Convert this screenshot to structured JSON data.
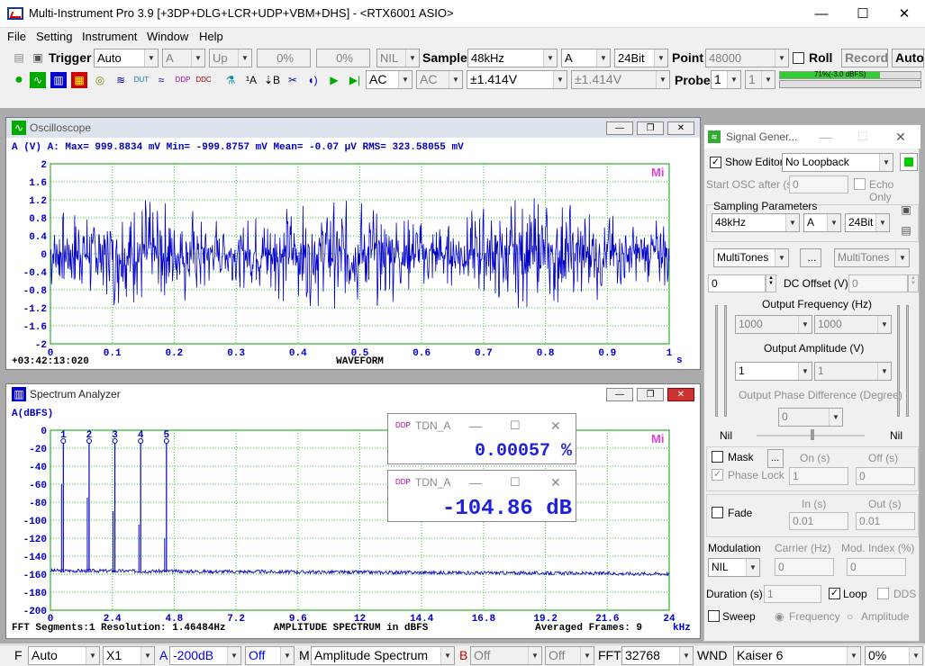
{
  "window": {
    "title": "Multi-Instrument Pro 3.9    [+3DP+DLG+LCR+UDP+VBM+DHS]    -    <RTX6001 ASIO>",
    "min": "—",
    "max": "☐",
    "close": "✕"
  },
  "menu": [
    "File",
    "Setting",
    "Instrument",
    "Window",
    "Help"
  ],
  "toolbar1": {
    "trigger_label": "Trigger",
    "trigger_mode": "Auto",
    "channel": "A",
    "edge": "Up",
    "level1": "0%",
    "level2": "0%",
    "nil": "NIL",
    "sample_label": "Sample",
    "sample_rate": "48kHz",
    "sample_ch": "A",
    "bits": "24Bit",
    "point_label": "Point",
    "points": "48000",
    "roll_label": "Roll",
    "record_label": "Record",
    "auto_label": "Auto"
  },
  "toolbar2": {
    "coupling_a": "AC",
    "coupling_b": "AC",
    "range_a": "±1.414V",
    "range_b": "±1.414V",
    "probe_label": "Probe",
    "probe_a": "1",
    "probe_b": "1",
    "meter_text": "71%(-3.0 dBFS)"
  },
  "oscilloscope": {
    "title": "Oscilloscope",
    "header": "A (V)      A: Max=   999.8834 mV  Min=  -999.8757 mV  Mean=        -0.07 μV  RMS=    323.58055 mV",
    "y_ticks": [
      "2",
      "1.6",
      "1.2",
      "0.8",
      "0.4",
      "0",
      "-0.4",
      "-0.8",
      "-1.2",
      "-1.6",
      "-2"
    ],
    "x_ticks": [
      "0",
      "0.1",
      "0.2",
      "0.3",
      "0.4",
      "0.5",
      "0.6",
      "0.7",
      "0.8",
      "0.9",
      "1"
    ],
    "x_unit": "s",
    "timestamp": "+03:42:13:020",
    "mode_label": "WAVEFORM",
    "logo": "Mi"
  },
  "spectrum": {
    "title": "Spectrum Analyzer",
    "header": "A(dBFS)",
    "y_ticks": [
      "0",
      "-20",
      "-40",
      "-60",
      "-80",
      "-100",
      "-120",
      "-140",
      "-160",
      "-180",
      "-200"
    ],
    "x_ticks": [
      "0",
      "2.4",
      "4.8",
      "7.2",
      "9.6",
      "12",
      "14.4",
      "16.8",
      "19.2",
      "21.6",
      "24"
    ],
    "x_unit": "kHz",
    "footer_left": "FFT Segments:1    Resolution: 1.46484Hz",
    "footer_mid": "AMPLITUDE SPECTRUM in dBFS",
    "footer_right": "Averaged Frames: 9",
    "logo": "Mi",
    "markers": [
      "1",
      "2",
      "3",
      "4",
      "5"
    ]
  },
  "chart_data": {
    "type": "line",
    "title": "",
    "xlabel": "",
    "ylabel": "A(dBFS)",
    "xlim": [
      0,
      24
    ],
    "ylim": [
      -200,
      0
    ],
    "series": [
      {
        "values": [
          [
            0.5,
            -12
          ],
          [
            1.5,
            -12
          ],
          [
            2.5,
            -12
          ],
          [
            3.5,
            -12
          ],
          [
            4.5,
            -12
          ]
        ]
      }
    ]
  },
  "tdn1": {
    "title": "TDN_A",
    "value": "0.00057 %"
  },
  "tdn2": {
    "title": "TDN_A",
    "value": "-104.86 dB"
  },
  "siggen": {
    "title": "Signal Gener...",
    "show_editor": "Show Editor",
    "loopback": "No Loopback",
    "start_osc": "Start OSC after (s)",
    "start_val": "0",
    "echo": "Echo Only",
    "sampling": "Sampling Parameters",
    "rate": "48kHz",
    "ch": "A",
    "bits": "24Bit",
    "wave1": "MultiTones",
    "dots": "...",
    "wave2": "MultiTones",
    "dc_val": "0",
    "dc_label": "DC Offset (V)",
    "dc_val2": "0",
    "freq_label": "Output Frequency (Hz)",
    "freq1": "1000",
    "freq2": "1000",
    "amp_label": "Output Amplitude (V)",
    "amp1": "1",
    "amp2": "1",
    "phase_label": "Output Phase Difference (Degree)",
    "phase_val": "0",
    "nil_l": "Nil",
    "nil_r": "Nil",
    "mask": "Mask",
    "on": "On (s)",
    "off": "Off (s)",
    "phase_lock": "Phase Lock",
    "on_val": "1",
    "off_val": "0",
    "fade": "Fade",
    "in": "In (s)",
    "out": "Out (s)",
    "in_val": "0.01",
    "out_val": "0.01",
    "mod": "Modulation",
    "carrier": "Carrier (Hz)",
    "modidx": "Mod. Index (%)",
    "mod_val": "NIL",
    "carrier_val": "0",
    "modidx_val": "0",
    "duration": "Duration (s)",
    "dur_val": "1",
    "loop": "Loop",
    "dds": "DDS",
    "sweep": "Sweep",
    "frequency": "Frequency",
    "amplitude": "Amplitude"
  },
  "status": {
    "f": "F",
    "auto": "Auto",
    "x1": "X1",
    "a": "A",
    "range": "-200dB",
    "off1": "Off",
    "m": "M",
    "mode": "Amplitude Spectrum",
    "b": "B",
    "off2": "Off",
    "off3": "Off",
    "fft_label": "FFT",
    "fft": "32768",
    "wnd_label": "WND",
    "wnd": "Kaiser 6",
    "pct": "0%"
  }
}
